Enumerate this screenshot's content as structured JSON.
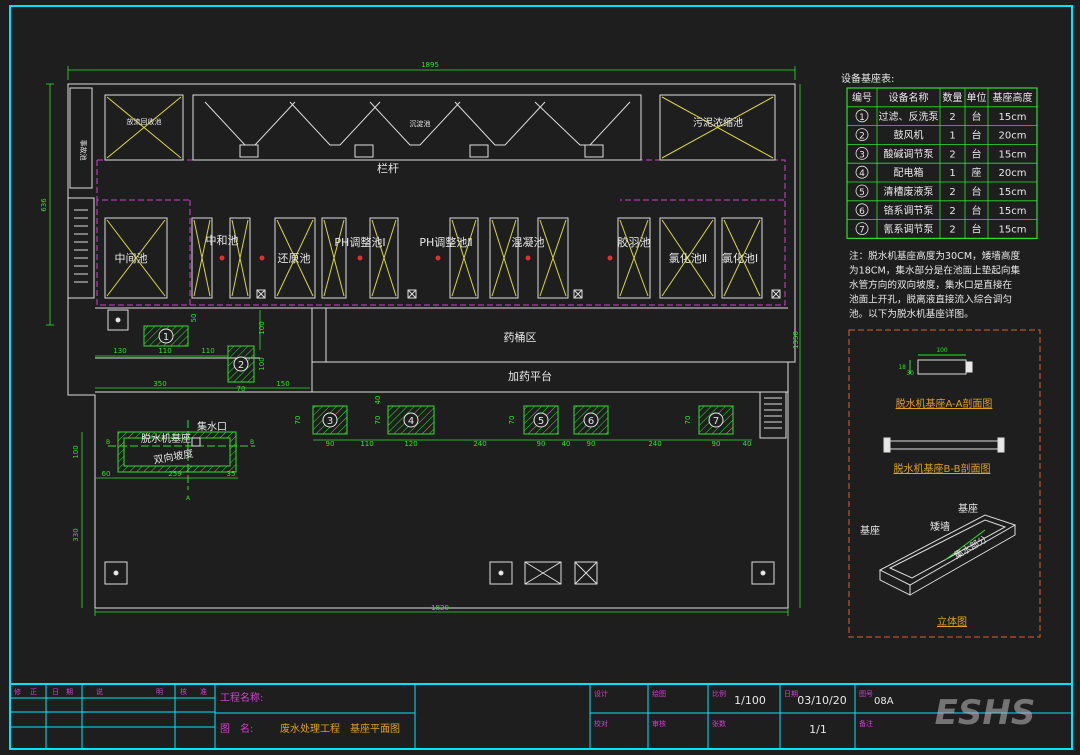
{
  "drawing": {
    "dim_top": "1895",
    "dim_bottom": "1820",
    "dim_left_upper": "636",
    "dim_right": "1350",
    "dim_left_lower": "330",
    "top_tanks": {
      "t1": "放流回收池",
      "t2": "沉淀池",
      "t3": "污泥浓缩池",
      "left_strip": "事故池"
    },
    "railing": "栏杆",
    "mid_tanks": {
      "zhongjian": "中间池",
      "zhonghe": "中和池",
      "huanyuan": "还原池",
      "ph1": "PH调整池Ⅰ",
      "ph2": "PH调整池Ⅱ",
      "hunning": "混凝池",
      "jiaoyu": "胶羽池",
      "yanghua2": "氯化池Ⅱ",
      "yanghua1": "氯化池Ⅰ"
    },
    "yaotong": "药桶区",
    "jiayao": "加药平台",
    "equip_nums": [
      "1",
      "2",
      "3",
      "4",
      "5",
      "6",
      "7"
    ],
    "dims": {
      "d130": "130",
      "d110a": "110",
      "d110b": "110",
      "d50": "50",
      "d100a": "100",
      "d100b": "100",
      "d70a": "70",
      "d350": "350",
      "d150": "150",
      "d70b": "70",
      "d90a": "90",
      "d110c": "110",
      "d120": "120",
      "d240a": "240",
      "d70c": "70",
      "d90b": "90",
      "d40": "40",
      "d90c": "90",
      "d240b": "240",
      "d70d": "70",
      "d90d": "90",
      "d70e": "70",
      "d40b": "40",
      "d40c": "40",
      "d100c": "100",
      "d60": "60",
      "d259": "259",
      "d35": "35"
    },
    "tuoshui_label": "脱水机基座",
    "jishui": "集水口",
    "podu": "双向坡度",
    "sec_a": "A",
    "sec_b": "B"
  },
  "equip_table": {
    "title": "设备基座表:",
    "headers": [
      "编号",
      "设备名称",
      "数量",
      "单位",
      "基座高度"
    ],
    "rows": [
      [
        "1",
        "过滤、反洗泵",
        "2",
        "台",
        "15cm"
      ],
      [
        "2",
        "鼓风机",
        "1",
        "台",
        "20cm"
      ],
      [
        "3",
        "酸碱调节泵",
        "2",
        "台",
        "15cm"
      ],
      [
        "4",
        "配电箱",
        "1",
        "座",
        "20cm"
      ],
      [
        "5",
        "清槽废液泵",
        "2",
        "台",
        "15cm"
      ],
      [
        "6",
        "铬系调节泵",
        "2",
        "台",
        "15cm"
      ],
      [
        "7",
        "氰系调节泵",
        "2",
        "台",
        "15cm"
      ]
    ]
  },
  "note": [
    "注：脱水机基座高度为30CM，矮墙高度",
    "为18CM，集水部分是在池面上垫起向集",
    "水管方向的双向坡度，集水口是直接在",
    "池面上开孔，脱离液直接流入综合调匀",
    "池。以下为脱水机基座详图。"
  ],
  "detail": {
    "dim100": "100",
    "dim18": "18",
    "dim30": "30",
    "sec_aa": "脱水机基座A-A剖面图",
    "sec_bb": "脱水机基座B-B剖面图",
    "jizuo1": "基座",
    "jizuo2": "基座",
    "aiqiang": "矮墙",
    "jishui_part": "集水部分",
    "iso": "立体图"
  },
  "title_block": {
    "rev_headers": [
      "修",
      "正",
      "日",
      "期",
      "说",
      "明",
      "核",
      "准"
    ],
    "project_label": "工程名称:",
    "drawing_label": "图　名:",
    "drawing_name": "废水处理工程　基座平面图",
    "design": "设计",
    "drafted": "绘图",
    "check": "校对",
    "audit": "审核",
    "scale_label": "比例",
    "scale": "1/100",
    "date_label": "日期",
    "date": "03/10/20",
    "drawing_no_label": "图号",
    "drawing_no": "08A",
    "sheets_label": "张数",
    "sheets": "1/1",
    "note_label": "备注"
  },
  "watermark": "ESHS",
  "colors": {
    "bg": "#1e1e1e",
    "frame": "#00e5ff",
    "wall": "#dddddd",
    "dim": "#2ee02e",
    "tank_x": "#d8d83a",
    "magenta": "#d040d0",
    "cyan": "#00e5ff",
    "white": "#e8e8e8",
    "orange": "#e0a020",
    "red": "#e03030",
    "detail_border": "#e06030"
  }
}
